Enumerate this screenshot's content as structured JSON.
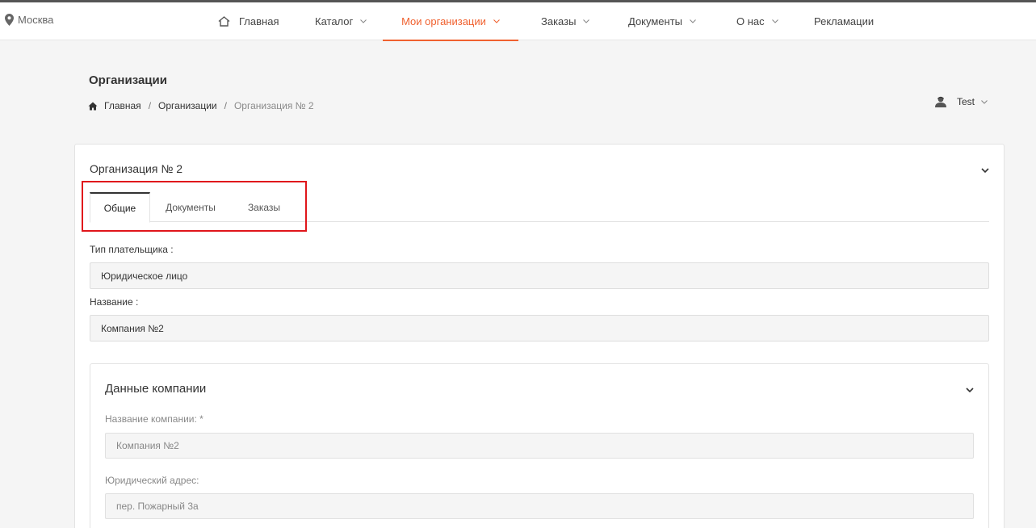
{
  "header": {
    "city": "Москва",
    "nav": [
      {
        "label": "Главная"
      },
      {
        "label": "Каталог"
      },
      {
        "label": "Мои организации"
      },
      {
        "label": "Заказы"
      },
      {
        "label": "Документы"
      },
      {
        "label": "О нас"
      },
      {
        "label": "Рекламации"
      }
    ],
    "accent_color": "#f0612f"
  },
  "page": {
    "title": "Организации",
    "breadcrumb": [
      "Главная",
      "Организации",
      "Организация № 2"
    ],
    "user": "Test"
  },
  "card": {
    "title": "Организация № 2",
    "tabs": [
      "Общие",
      "Документы",
      "Заказы"
    ],
    "active_tab": "Общие",
    "payer_type_label": "Тип плательщика :",
    "payer_type_value": "Юридическое лицо",
    "name_label": "Название :",
    "name_value": "Компания №2"
  },
  "company": {
    "title": "Данные компании",
    "company_name_label": "Название компании: *",
    "company_name_value": "Компания №2",
    "legal_address_label": "Юридический адрес:",
    "legal_address_value": "пер. Пожарный 3а"
  },
  "icons": [
    "map-pin-icon",
    "home-icon",
    "chevron-down-icon",
    "user-avatar-icon"
  ],
  "highlight_color": "#e0161b"
}
